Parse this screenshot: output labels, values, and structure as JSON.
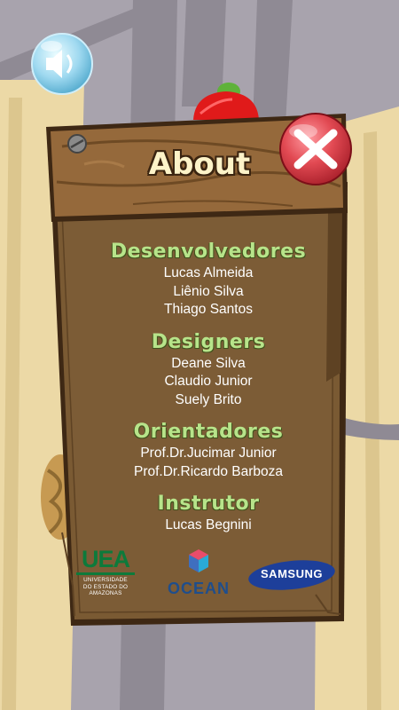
{
  "window": {
    "title": "About"
  },
  "controls": {
    "sound_icon": "speaker-icon",
    "close_label": "X"
  },
  "sections": [
    {
      "heading": "Desenvolvedores",
      "names": [
        "Lucas Almeida",
        "Liênio Silva",
        "Thiago Santos"
      ]
    },
    {
      "heading": "Designers",
      "names": [
        "Deane Silva",
        "Claudio Junior",
        "Suely Brito"
      ]
    },
    {
      "heading": "Orientadores",
      "names": [
        "Prof.Dr.Jucimar Junior",
        "Prof.Dr.Ricardo Barboza"
      ]
    },
    {
      "heading": "Instrutor",
      "names": [
        "Lucas Begnini"
      ]
    }
  ],
  "logos": {
    "uea": {
      "mark": "UEA",
      "line1": "UNIVERSIDADE",
      "line2": "DO ESTADO DO",
      "line3": "AMAZONAS"
    },
    "ocean": {
      "text": "OCEAN"
    },
    "samsung": {
      "text": "SAMSUNG"
    }
  },
  "colors": {
    "heading": "#b7e48a",
    "wood": "#7a5a33",
    "close_red": "#d9434b",
    "sky": "#a8a3ad",
    "tree": "#ecd9a6"
  }
}
